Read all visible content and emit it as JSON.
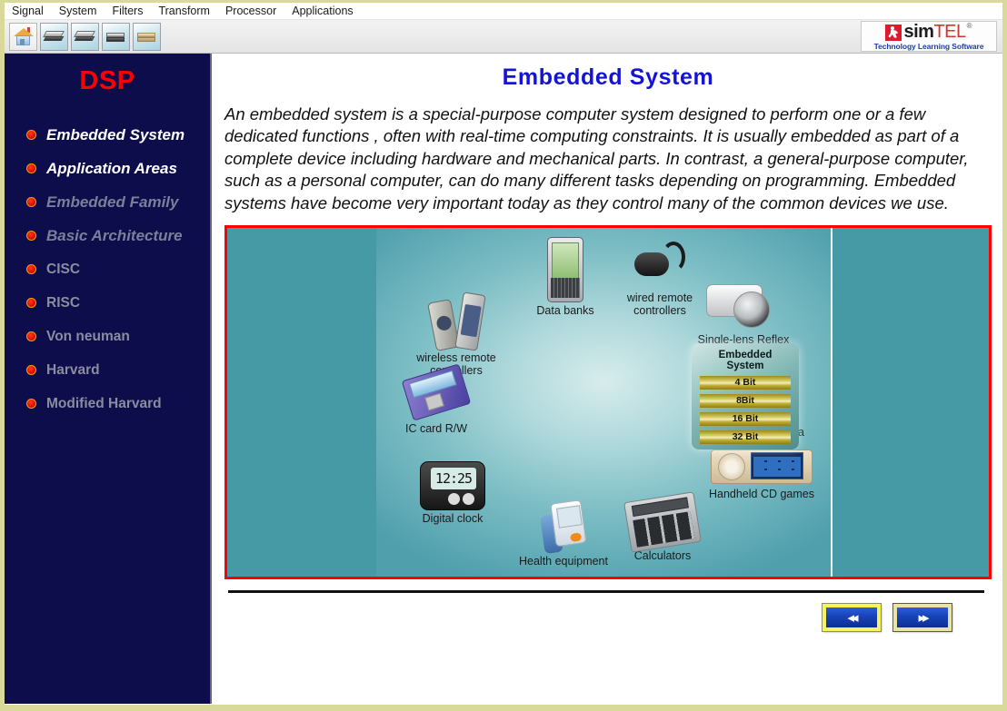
{
  "menubar": {
    "items": [
      "Signal",
      "System",
      "Filters",
      "Transform",
      "Processor",
      "Applications"
    ]
  },
  "toolbar": {
    "buttons": [
      {
        "name": "home",
        "label": "Home"
      },
      {
        "name": "book1",
        "label": "Book 1"
      },
      {
        "name": "book2",
        "label": "Book 2"
      },
      {
        "name": "book3",
        "label": "Book 3"
      },
      {
        "name": "book4",
        "label": "Book 4"
      }
    ]
  },
  "logo": {
    "brand_left": "sim",
    "brand_right": "TEL",
    "registered": "®",
    "tagline": "Technology Learning Software",
    "mark_color": "#e0192b",
    "tagline_color": "#1a3f9e"
  },
  "sidebar": {
    "title": "DSP",
    "title_color": "#ff0000",
    "background": "#0d0d4c",
    "items": [
      {
        "label": "Embedded System",
        "state": "active"
      },
      {
        "label": "Application Areas",
        "state": "active"
      },
      {
        "label": "Embedded Family",
        "state": "dim"
      },
      {
        "label": "Basic  Architecture",
        "state": "dim"
      },
      {
        "label": "CISC",
        "state": "plain"
      },
      {
        "label": "RISC",
        "state": "plain"
      },
      {
        "label": "Von neuman",
        "state": "plain"
      },
      {
        "label": "Harvard",
        "state": "plain"
      },
      {
        "label": "Modified Harvard",
        "state": "plain"
      }
    ]
  },
  "content": {
    "title": "Embedded  System",
    "title_color": "#1414d2",
    "paragraph": "An embedded system is a special-purpose computer system designed to perform one or a few dedicated functions , often with real-time computing constraints. It is usually embedded as part of a complete device including hardware and mechanical parts. In contrast, a general-purpose computer, such as a personal computer, can do many different tasks depending on programming. Embedded systems have become very important today as they control many of the common devices we use."
  },
  "illustration": {
    "border_color": "#ff0000",
    "background_color": "#459aa5",
    "center_box": {
      "title": "Embedded System",
      "bars": [
        "4 Bit",
        "8Bit",
        "16 Bit",
        "32 Bit"
      ]
    },
    "devices": [
      {
        "key": "wireless_remote",
        "label": "wireless remote controllers"
      },
      {
        "key": "data_banks",
        "label": "Data banks"
      },
      {
        "key": "wired_remote",
        "label": "wired remote controllers"
      },
      {
        "key": "slr_camera",
        "label": "Single-lens Reflex Camera"
      },
      {
        "key": "lens_shutter_camera",
        "label": "Lens shutter camera"
      },
      {
        "key": "handheld_cd_games",
        "label": "Handheld CD games"
      },
      {
        "key": "ic_card_rw",
        "label": "IC card R/W"
      },
      {
        "key": "digital_clock",
        "label": "Digital clock",
        "display_value": "12:25"
      },
      {
        "key": "health_equipment",
        "label": "Health equipment"
      },
      {
        "key": "calculators",
        "label": "Calculators"
      }
    ]
  },
  "footer": {
    "prev_label": "◂◂",
    "next_label": "▸▸",
    "prev_name": "Previous",
    "next_name": "Next"
  }
}
